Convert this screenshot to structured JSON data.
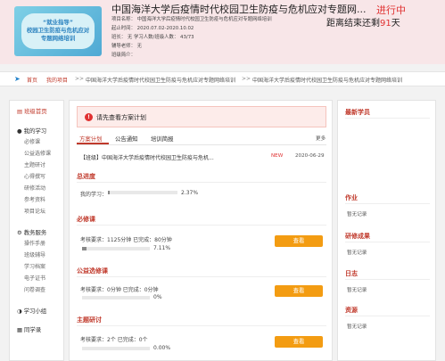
{
  "header": {
    "banner_text": [
      "“就业指导”",
      "校园卫生防疫与危机应对",
      "专题网络培训"
    ],
    "course_title": "中国海洋大学后疫情时代校园卫生防疫与危机应对专题网...",
    "status": "进行中",
    "countdown_prefix": "距离结束还剩",
    "countdown_days": "91",
    "countdown_suffix": "天",
    "meta": {
      "name_line": "项目名称：  中国海洋大学后疫情时代校园卫生防疫与危机应对专题网络培训",
      "period_line": "起止时间：  2020.07.02-2020.10.02",
      "count_line": "班长：  无        学习人数/班级人数：  43/73",
      "tutor_line": "辅导老师：  无",
      "intro_line": "班级简介："
    }
  },
  "breadcrumb": {
    "home": "首页",
    "my_project": "我的项目",
    "sep": ">>",
    "project": "中国海洋大学后疫情时代校园卫生防疫与危机应对专题网络培训",
    "class": "中国海洋大学后疫情时代校园卫生防疫与危机应对专题网络培训"
  },
  "sidebar": {
    "class_home": "班级首页",
    "my_study": "我的学习",
    "study_items": [
      "必修课",
      "公益选修课",
      "主题研讨",
      "心得撰写",
      "研修活动",
      "参考资料",
      "项目论坛"
    ],
    "admin": "教务服务",
    "admin_items": [
      "操作手册",
      "班级辅导",
      "学习档案",
      "电子证书",
      "问卷调查"
    ],
    "group": "学习小组",
    "classmates": "同学录"
  },
  "main": {
    "notice": "请先查看方案计划",
    "notice_icon": "exclamation-icon",
    "tabs": [
      "方案计划",
      "公告通知",
      "培训简报"
    ],
    "more": "更多",
    "news": {
      "title": "【班级】中国海洋大学后疫情时代校园卫生防疫与危机...",
      "badge": "NEW",
      "date": "2020-06-29"
    },
    "progress": {
      "title": "总进度",
      "label": "我的学习：",
      "pct_text": "2.37%",
      "value": 0.0237
    },
    "sections": [
      {
        "title": "必修课",
        "line": "考核要求：1125分钟  已完成：80分钟",
        "pct_text": "7.11%",
        "value": 0.0711,
        "button": "查看"
      },
      {
        "title": "公益选修课",
        "line": "考核要求：0分钟  已完成：0分钟",
        "pct_text": "0%",
        "value": 0,
        "button": "查看"
      },
      {
        "title": "主题研讨",
        "line": "考核要求：2个  已完成：0个",
        "pct_text": "0.00%",
        "value": 0,
        "button": "查看"
      }
    ]
  },
  "right": {
    "new_students": "最新学员",
    "blocks": [
      {
        "title": "作业",
        "empty": "暂无记录"
      },
      {
        "title": "研修成果",
        "empty": "暂无记录"
      },
      {
        "title": "日志",
        "empty": "暂无记录"
      },
      {
        "title": "资源",
        "empty": "暂无记录"
      }
    ]
  },
  "colors": {
    "accent": "#c0392b",
    "button": "#f39c12",
    "status": "#e03131"
  }
}
